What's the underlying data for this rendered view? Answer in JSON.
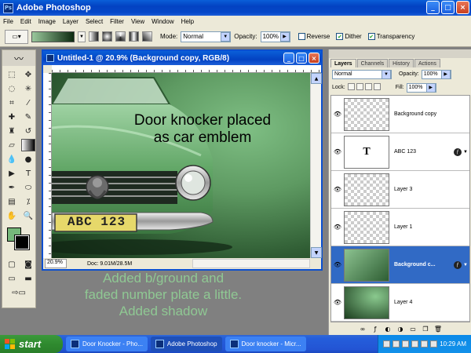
{
  "window": {
    "title": "Adobe Photoshop",
    "buttons": {
      "minimize": "_",
      "maximize": "□",
      "close": "×"
    }
  },
  "menu": [
    "File",
    "Edit",
    "Image",
    "Layer",
    "Select",
    "Filter",
    "View",
    "Window",
    "Help"
  ],
  "options": {
    "mode_label": "Mode:",
    "mode_value": "Normal",
    "opacity_label": "Opacity:",
    "opacity_value": "100%",
    "reverse_label": "Reverse",
    "dither_label": "Dither",
    "transparency_label": "Transparency"
  },
  "document": {
    "title": "Untitled-1 @ 20.9% (Background copy, RGB/8)",
    "canvas_text_line1": "Door knocker placed",
    "canvas_text_line2": "as car emblem",
    "plate_text": "ABC  123",
    "zoom": "20.9%",
    "doc_info": "Doc: 9.01M/28.5M"
  },
  "caption": {
    "line1": "Added b/ground and",
    "line2": "faded number plate a little.",
    "line3": "Added shadow"
  },
  "layers_panel": {
    "tabs": [
      "Layers",
      "Channels",
      "History",
      "Actions"
    ],
    "blend_mode": "Normal",
    "opacity_label": "Opacity:",
    "opacity_value": "100%",
    "lock_label": "Lock:",
    "fill_label": "Fill:",
    "fill_value": "100%",
    "layers": [
      {
        "name": "Background copy",
        "type": "transparent",
        "selected": false
      },
      {
        "name": "ABC   123",
        "type": "text",
        "thumb_text": "T",
        "selected": false
      },
      {
        "name": "Layer 3",
        "type": "transparent",
        "selected": false
      },
      {
        "name": "Layer 1",
        "type": "transparent",
        "selected": false
      },
      {
        "name": "Background c...",
        "type": "car",
        "selected": true
      },
      {
        "name": "Layer 4",
        "type": "gradient",
        "selected": false
      }
    ]
  },
  "taskbar": {
    "start": "start",
    "tasks": [
      "Door Knocker - Pho...",
      "Adobe Photoshop",
      "Door knocker - Micr..."
    ],
    "clock": "10:29 AM"
  }
}
